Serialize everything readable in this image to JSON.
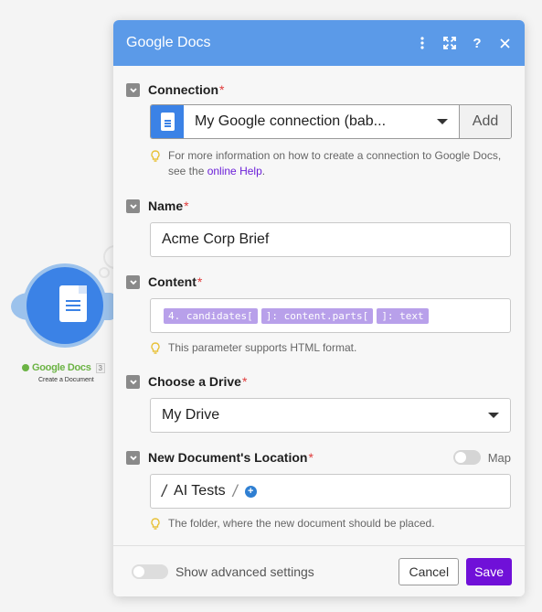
{
  "module": {
    "name": "Google Docs",
    "badge": "3",
    "subtitle": "Create a Document"
  },
  "dialog": {
    "title": "Google Docs",
    "header_icons": [
      "more-vertical-icon",
      "expand-icon",
      "help-icon",
      "close-icon"
    ]
  },
  "connection": {
    "label": "Connection",
    "required": "*",
    "value": "My Google connection (bab...",
    "add_label": "Add",
    "hint_prefix": "For more information on how to create a connection to Google Docs, see the ",
    "hint_link": "online Help",
    "hint_suffix": "."
  },
  "name_field": {
    "label": "Name",
    "required": "*",
    "value": "Acme Corp Brief"
  },
  "content": {
    "label": "Content",
    "required": "*",
    "pills": [
      "4. candidates[",
      "]: content.parts[",
      "]: text"
    ],
    "hint": "This parameter supports HTML format."
  },
  "drive": {
    "label": "Choose a Drive",
    "required": "*",
    "value": "My Drive"
  },
  "location": {
    "label": "New Document's Location",
    "required": "*",
    "map_label": "Map",
    "path_sep": "/",
    "folder": "AI Tests",
    "hint": "The folder, where the new document should be placed."
  },
  "footer": {
    "advanced_label": "Show advanced settings",
    "cancel_label": "Cancel",
    "save_label": "Save"
  },
  "colors": {
    "header": "#5b9ae8",
    "save": "#7010d8",
    "pill": "#b8a0ea",
    "module_label": "#6bb344"
  }
}
